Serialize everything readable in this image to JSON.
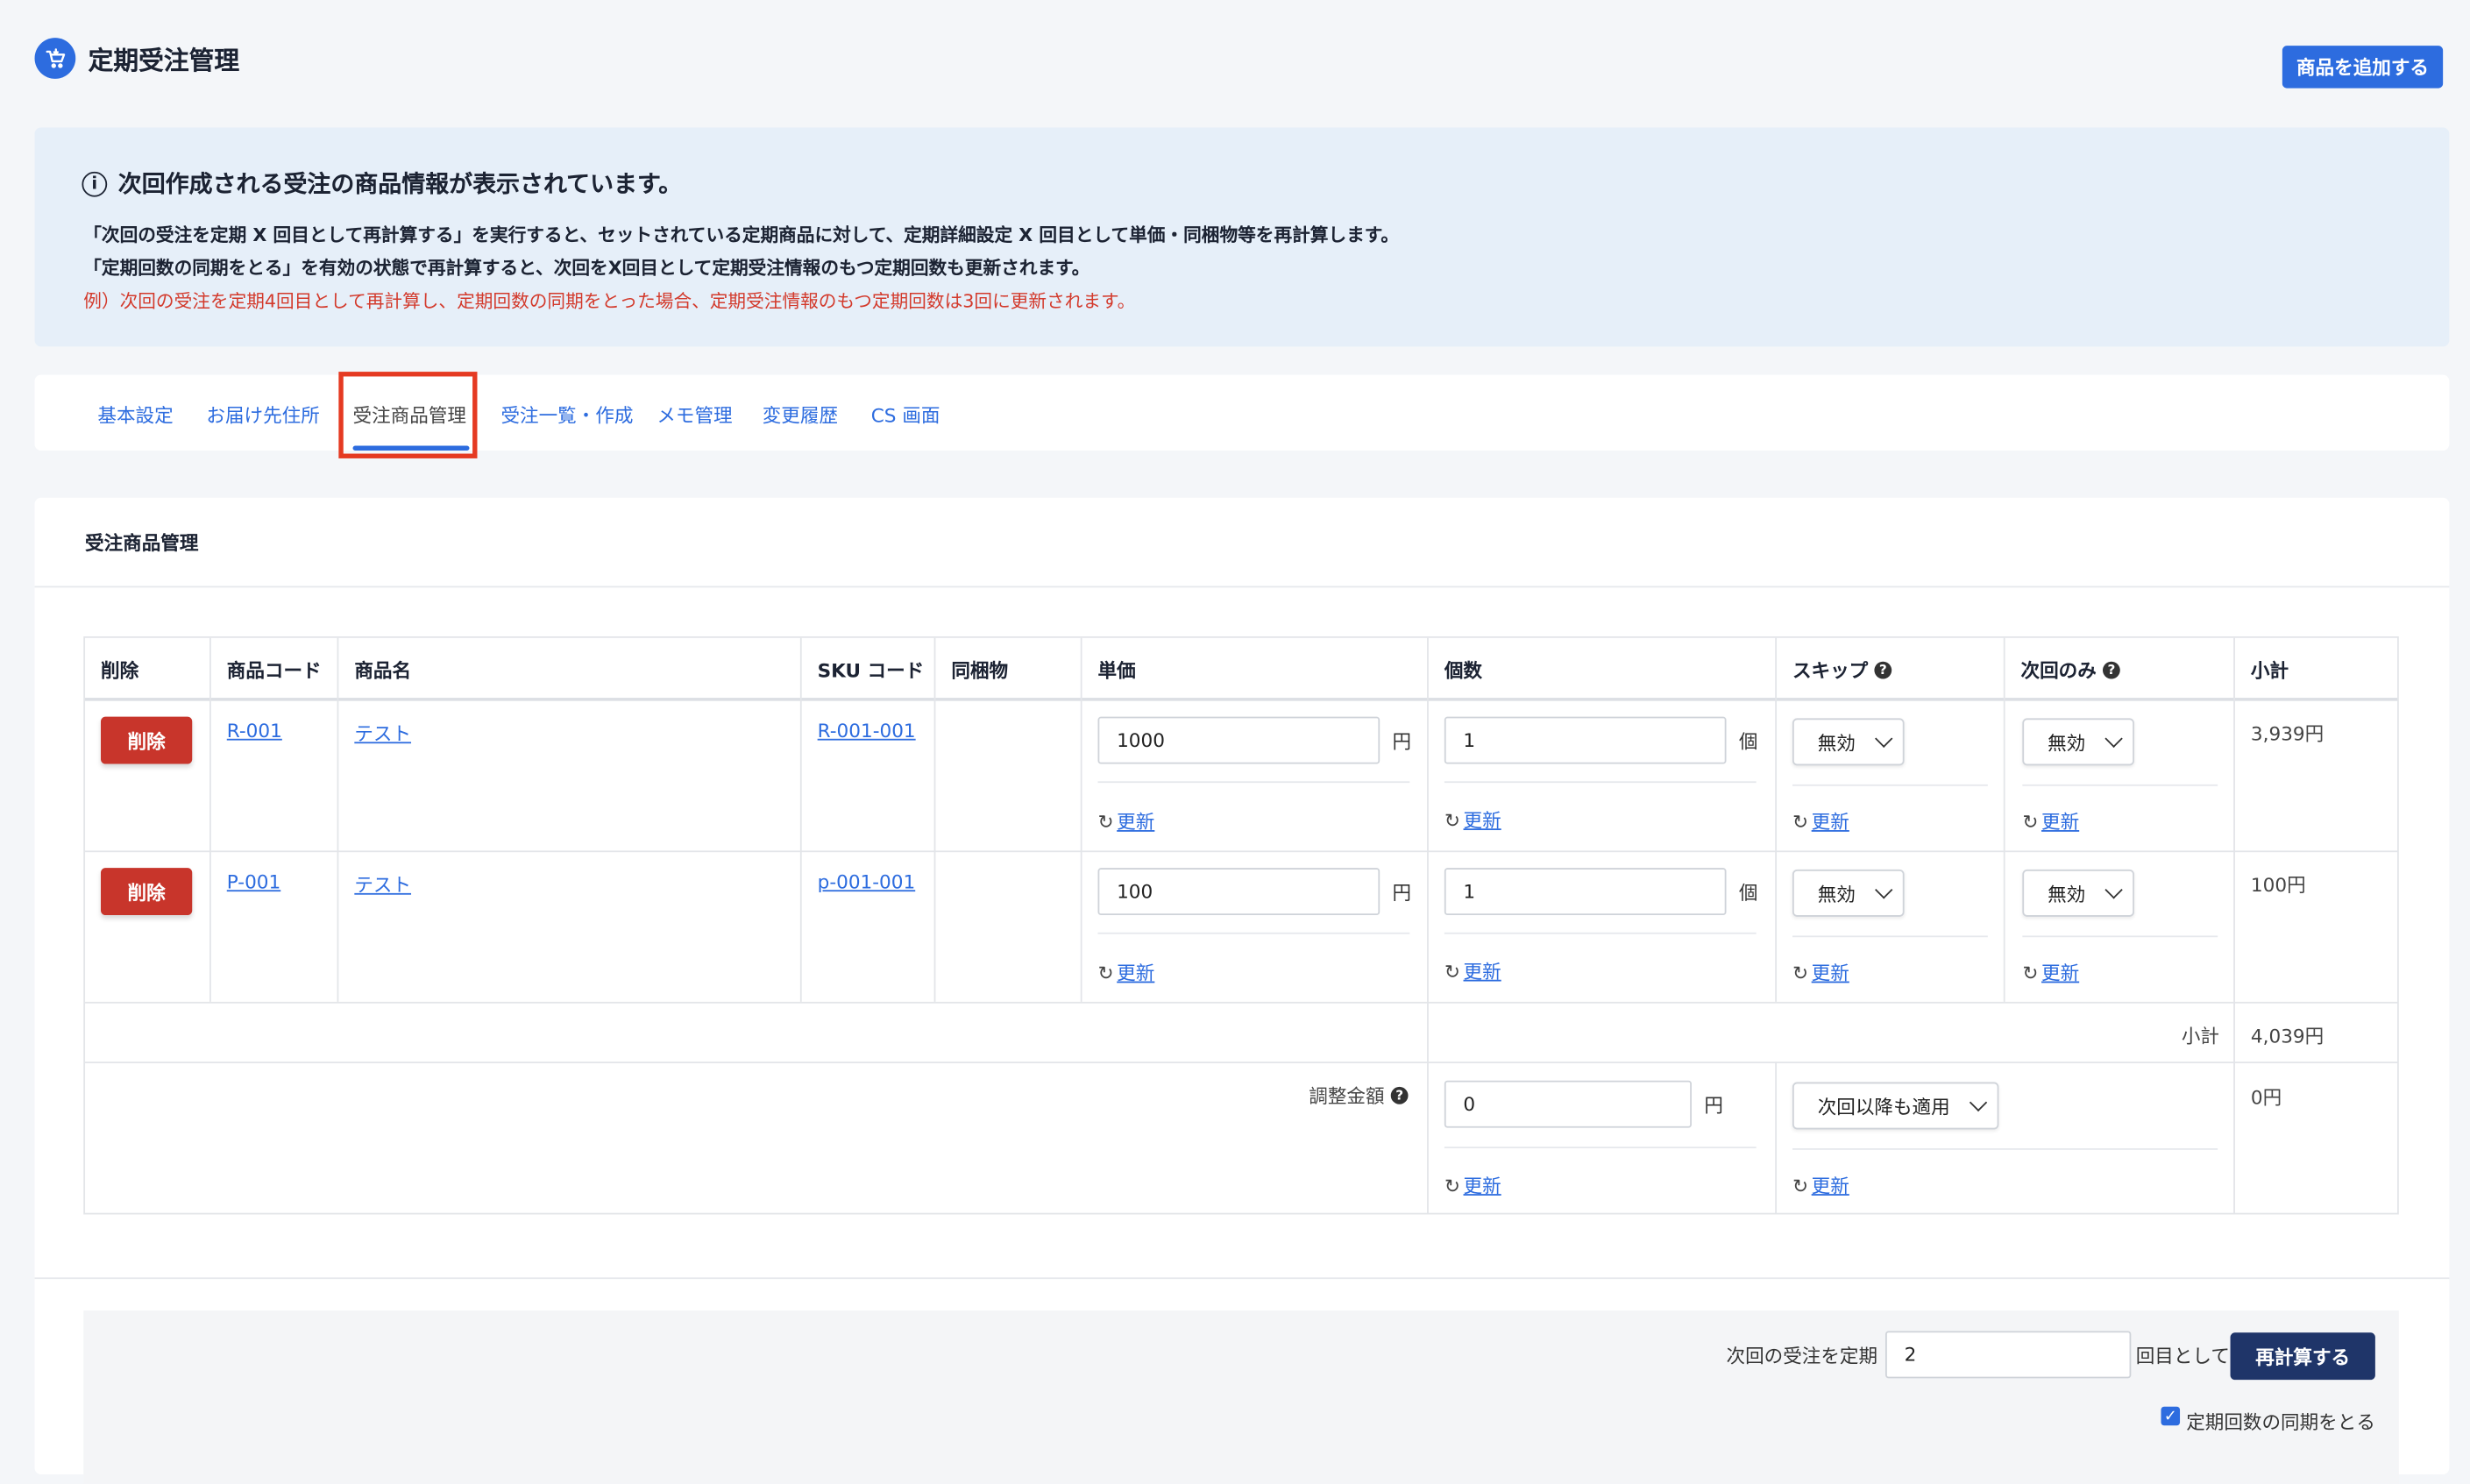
{
  "header": {
    "title": "定期受注管理",
    "add_product_label": "商品を追加する",
    "brand_color": "#2d6cdf"
  },
  "info": {
    "heading": "次回作成される受注の商品情報が表示されています。",
    "line1": "「次回の受注を定期 X 回目として再計算する」を実行すると、セットされている定期商品に対して、定期詳細設定 X 回目として単価・同梱物等を再計算します。",
    "line2": "「定期回数の同期をとる」を有効の状態で再計算すると、次回をX回目として定期受注情報のもつ定期回数も更新されます。",
    "line3": "例）次回の受注を定期4回目として再計算し、定期回数の同期をとった場合、定期受注情報のもつ定期回数は3回に更新されます。"
  },
  "tabs": [
    {
      "label": "基本設定"
    },
    {
      "label": "お届け先住所"
    },
    {
      "label": "受注商品管理",
      "active": true
    },
    {
      "label": "受注一覧・作成"
    },
    {
      "label": "メモ管理"
    },
    {
      "label": "変更履歴"
    },
    {
      "label": "CS 画面"
    }
  ],
  "section": {
    "title": "受注商品管理"
  },
  "table": {
    "headers": {
      "delete": "削除",
      "product_code": "商品コード",
      "product_name": "商品名",
      "sku_code": "SKU コード",
      "bundle": "同梱物",
      "unit_price": "単価",
      "quantity": "個数",
      "skip": "スキップ",
      "next_only": "次回のみ",
      "subtotal": "小計"
    },
    "rows": [
      {
        "delete_label": "削除",
        "product_code": "R-001",
        "product_name": "テスト",
        "sku_code": "R-001-001",
        "unit_price": "1000",
        "price_unit": "円",
        "quantity": "1",
        "qty_unit": "個",
        "skip": "無効",
        "next_only": "無効",
        "subtotal": "3,939円",
        "update_label": "更新"
      },
      {
        "delete_label": "削除",
        "product_code": "P-001",
        "product_name": "テスト",
        "sku_code": "p-001-001",
        "unit_price": "100",
        "price_unit": "円",
        "quantity": "1",
        "qty_unit": "個",
        "skip": "無効",
        "next_only": "無効",
        "subtotal": "100円",
        "update_label": "更新"
      }
    ],
    "subtotal_label": "小計",
    "subtotal_value": "4,039円",
    "adjustment": {
      "label": "調整金額",
      "value": "0",
      "unit": "円",
      "apply_option": "次回以降も適用",
      "result": "0円",
      "update_label": "更新"
    }
  },
  "recalc": {
    "prefix": "次回の受注を定期",
    "count": "2",
    "suffix": "回目として",
    "button": "再計算する",
    "sync_label": "定期回数の同期をとる",
    "sync_checked": true
  }
}
